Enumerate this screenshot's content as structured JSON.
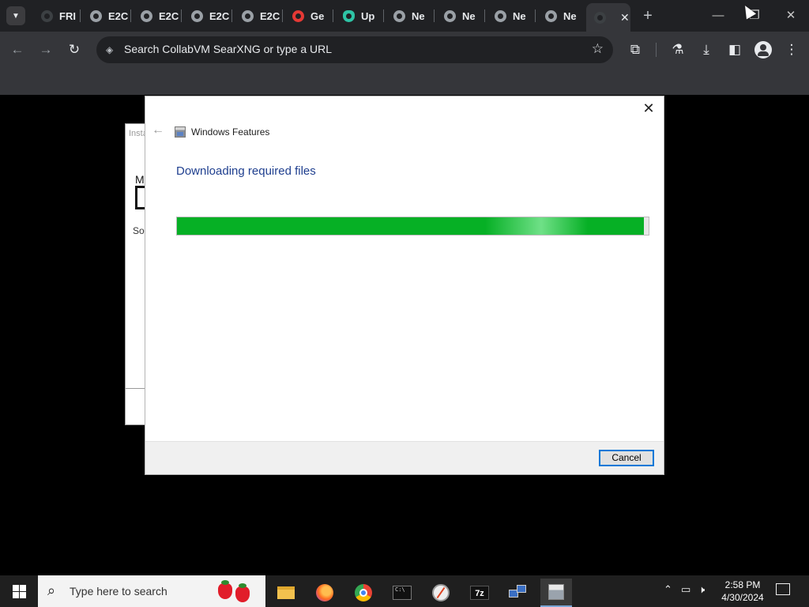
{
  "browser": {
    "tabs": [
      {
        "label": "FRI",
        "icon": "dark-favicon"
      },
      {
        "label": "E2C",
        "icon": "globe-icon"
      },
      {
        "label": "E2C",
        "icon": "globe-icon"
      },
      {
        "label": "E2C",
        "icon": "globe-icon"
      },
      {
        "label": "E2C",
        "icon": "globe-icon"
      },
      {
        "label": "Ge",
        "icon": "red-favicon"
      },
      {
        "label": "Up",
        "icon": "cloud-icon"
      },
      {
        "label": "Ne",
        "icon": "globe-icon"
      },
      {
        "label": "Ne",
        "icon": "globe-icon"
      },
      {
        "label": "Ne",
        "icon": "globe-icon"
      },
      {
        "label": "Ne",
        "icon": "globe-icon"
      }
    ],
    "active_tab_close": "✕",
    "new_tab": "+",
    "window_controls": {
      "minimize": "—",
      "restore": "❐",
      "close": "✕"
    },
    "omnibox": {
      "text": "Search CollabVM SearXNG or type a URL"
    }
  },
  "dialog": {
    "title": "Windows Features",
    "heading": "Downloading required files",
    "progress": 0.99,
    "cancel_label": "Cancel",
    "close": "✕",
    "back": "←"
  },
  "background_window": {
    "title": "Insta",
    "line1": "M",
    "line2": "So"
  },
  "taskbar": {
    "search_placeholder": "Type here to search",
    "time": "2:58 PM",
    "date": "4/30/2024",
    "app_7z": "7z"
  },
  "colors": {
    "progress_fill": "#06b025",
    "heading": "#1f3f8f",
    "button_border": "#0078d7"
  }
}
